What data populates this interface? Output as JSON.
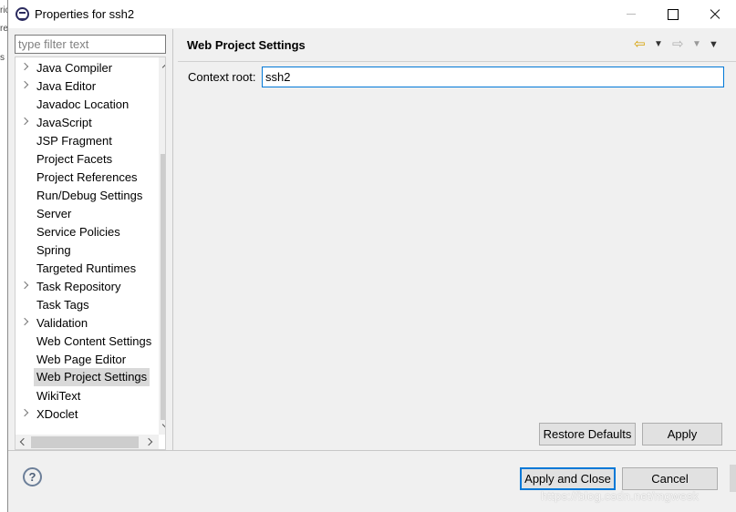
{
  "window": {
    "title": "Properties for ssh2"
  },
  "filter": {
    "placeholder": "type filter text"
  },
  "tree": {
    "items": [
      {
        "label": "Java Compiler",
        "expandable": true
      },
      {
        "label": "Java Editor",
        "expandable": true
      },
      {
        "label": "Javadoc Location",
        "expandable": false
      },
      {
        "label": "JavaScript",
        "expandable": true
      },
      {
        "label": "JSP Fragment",
        "expandable": false
      },
      {
        "label": "Project Facets",
        "expandable": false
      },
      {
        "label": "Project References",
        "expandable": false
      },
      {
        "label": "Run/Debug Settings",
        "expandable": false
      },
      {
        "label": "Server",
        "expandable": false
      },
      {
        "label": "Service Policies",
        "expandable": false
      },
      {
        "label": "Spring",
        "expandable": false
      },
      {
        "label": "Targeted Runtimes",
        "expandable": false
      },
      {
        "label": "Task Repository",
        "expandable": true
      },
      {
        "label": "Task Tags",
        "expandable": false
      },
      {
        "label": "Validation",
        "expandable": true
      },
      {
        "label": "Web Content Settings",
        "expandable": false
      },
      {
        "label": "Web Page Editor",
        "expandable": false
      },
      {
        "label": "Web Project Settings",
        "expandable": false,
        "selected": true
      },
      {
        "label": "WikiText",
        "expandable": false
      },
      {
        "label": "XDoclet",
        "expandable": true
      }
    ]
  },
  "page": {
    "title": "Web Project Settings",
    "context_root_label": "Context root:",
    "context_root_value": "ssh2"
  },
  "buttons": {
    "restore_defaults": "Restore Defaults",
    "apply": "Apply",
    "apply_and_close": "Apply and Close",
    "cancel": "Cancel",
    "help": "?"
  },
  "watermark": "https://blog.csdn.net/mgwesk",
  "icons": {
    "back": "back-arrow-icon",
    "forward": "forward-arrow-icon",
    "menu": "view-menu-icon"
  },
  "colors": {
    "accent": "#0078d7",
    "selection": "#d9d9d9",
    "back_arrow": "#d6a000"
  }
}
